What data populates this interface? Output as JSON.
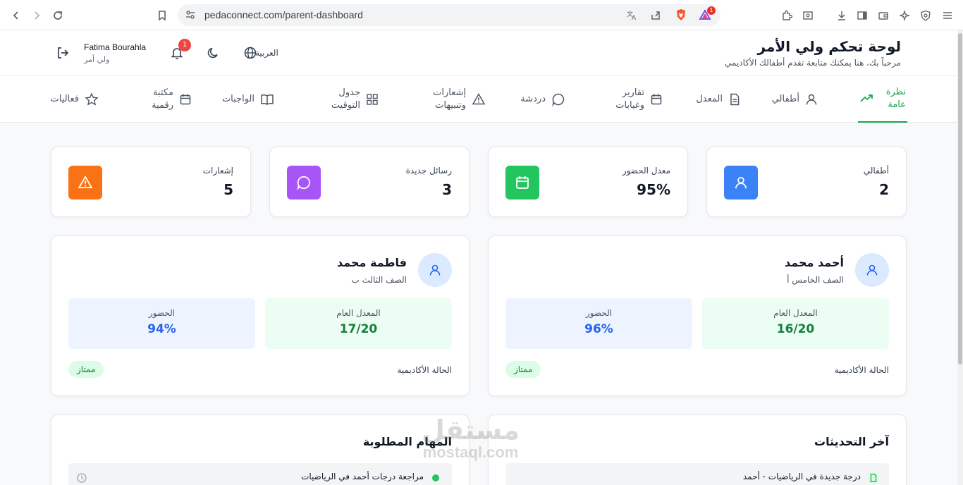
{
  "browser": {
    "url": "pedaconnect.com/parent-dashboard",
    "extension_badge": "1"
  },
  "header": {
    "title": "لوحة تحكم ولي الأمر",
    "subtitle": "مرحباً بك، هنا يمكنك متابعة تقدم أطفالك الأكاديمي",
    "user_name": "Fatima Bourahla",
    "user_role": "ولي أمر",
    "notification_count": "1",
    "language": "العربية"
  },
  "tabs": [
    {
      "label": "نظرة عامة",
      "icon": "trend-icon",
      "active": true
    },
    {
      "label": "أطفالي",
      "icon": "user-icon",
      "active": false
    },
    {
      "label": "المعدل",
      "icon": "document-icon",
      "active": false
    },
    {
      "label": "تقارير وغيابات",
      "icon": "calendar-icon",
      "active": false
    },
    {
      "label": "دردشة",
      "icon": "chat-icon",
      "active": false
    },
    {
      "label": "إشعارات وتنبيهات",
      "icon": "warning-icon",
      "active": false
    },
    {
      "label": "جدول التوقيت",
      "icon": "grid-icon",
      "active": false
    },
    {
      "label": "الواجبات",
      "icon": "book-icon",
      "active": false
    },
    {
      "label": "مكتبة رقمية",
      "icon": "calendar-icon",
      "active": false
    },
    {
      "label": "فعاليات",
      "icon": "star-icon",
      "active": false
    }
  ],
  "stats": [
    {
      "label": "أطفالي",
      "value": "2",
      "color": "#3b82f6",
      "icon": "user-icon"
    },
    {
      "label": "معدل الحضور",
      "value": "95%",
      "color": "#22c55e",
      "icon": "calendar-icon"
    },
    {
      "label": "رسائل جديدة",
      "value": "3",
      "color": "#a855f7",
      "icon": "chat-icon"
    },
    {
      "label": "إشعارات",
      "value": "5",
      "color": "#f97316",
      "icon": "warning-icon"
    }
  ],
  "children": [
    {
      "name": "أحمد محمد",
      "class": "الصف الخامس أ",
      "gpa_label": "المعدل العام",
      "gpa": "16/20",
      "attendance_label": "الحضور",
      "attendance": "96%",
      "status_label": "الحالة الأكاديمية",
      "status": "ممتاز"
    },
    {
      "name": "فاطمة محمد",
      "class": "الصف الثالث ب",
      "gpa_label": "المعدل العام",
      "gpa": "17/20",
      "attendance_label": "الحضور",
      "attendance": "94%",
      "status_label": "الحالة الأكاديمية",
      "status": "ممتاز"
    }
  ],
  "updates": {
    "title": "آخر التحديثات",
    "first_item": "درجة جديدة في الرياضيات - أحمد"
  },
  "tasks": {
    "title": "المهام المطلوبة",
    "first_item": "مراجعة درجات أحمد في الرياضيات"
  },
  "watermark": {
    "arabic": "مستقل",
    "latin": "mostaql.com"
  }
}
